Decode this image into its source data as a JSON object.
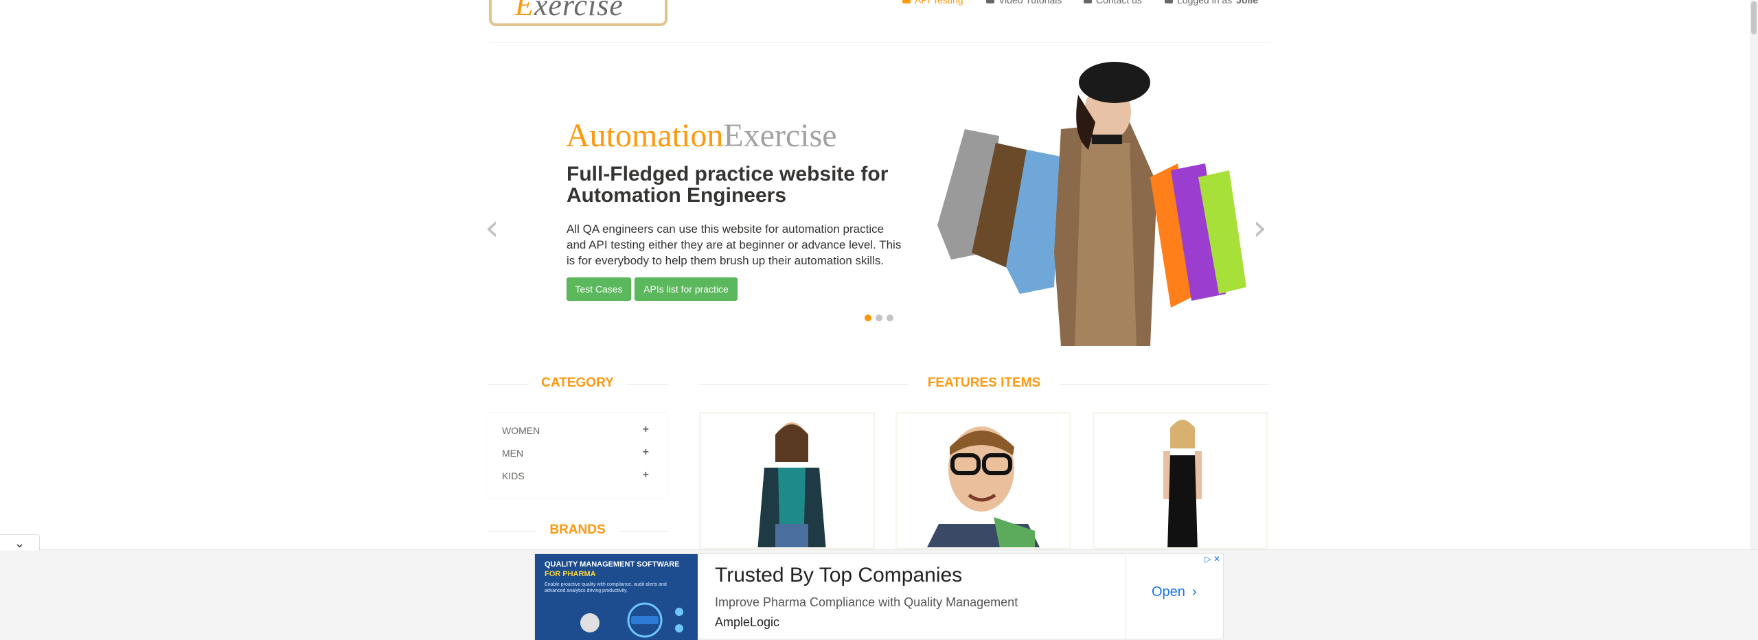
{
  "header": {
    "logo_first_letter": "E",
    "logo_rest": "xercise",
    "nav": [
      {
        "label": "API Testing",
        "icon": "list-icon",
        "active": true
      },
      {
        "label": "Video Tutorials",
        "icon": "video-icon",
        "active": false
      },
      {
        "label": "Contact us",
        "icon": "envelope-icon",
        "active": false
      },
      {
        "label": "Logged in as",
        "user": "Jolie",
        "icon": "user-icon",
        "active": false
      }
    ]
  },
  "carousel": {
    "brand_a": "Automation",
    "brand_b": "Exercise",
    "heading": "Full-Fledged practice website for Automation Engineers",
    "text": "All QA engineers can use this website for automation practice and API testing either they are at beginner or advance level. This is for everybody to help them brush up their automation skills.",
    "btn_test_cases": "Test Cases",
    "btn_apis": "APIs list for practice",
    "prev_arrow": "‹",
    "next_arrow": "›",
    "active_slide": 1,
    "slide_count": 3
  },
  "sidebar": {
    "category_title": "CATEGORY",
    "categories": [
      {
        "label": "WOMEN",
        "plus": "+"
      },
      {
        "label": "MEN",
        "plus": "+"
      },
      {
        "label": "KIDS",
        "plus": "+"
      }
    ],
    "brands_title": "BRANDS"
  },
  "features": {
    "title": "FEATURES ITEMS"
  },
  "ad": {
    "toggle": "⌄",
    "image_title": "QUALITY MANAGEMENT SOFTWARE",
    "image_title_sub": "FOR PHARMA",
    "image_small": "Enable proactive quality with compliance, audit alerts and advanced analytics driving productivity.",
    "headline": "Trusted By Top Companies",
    "description": "Improve Pharma Compliance with Quality Management",
    "advertiser": "AmpleLogic",
    "open_label": "Open",
    "choices": "▷ ✕"
  },
  "colors": {
    "accent": "#fe980f",
    "green": "#5cb85c",
    "ad_blue": "#1a73e8"
  }
}
